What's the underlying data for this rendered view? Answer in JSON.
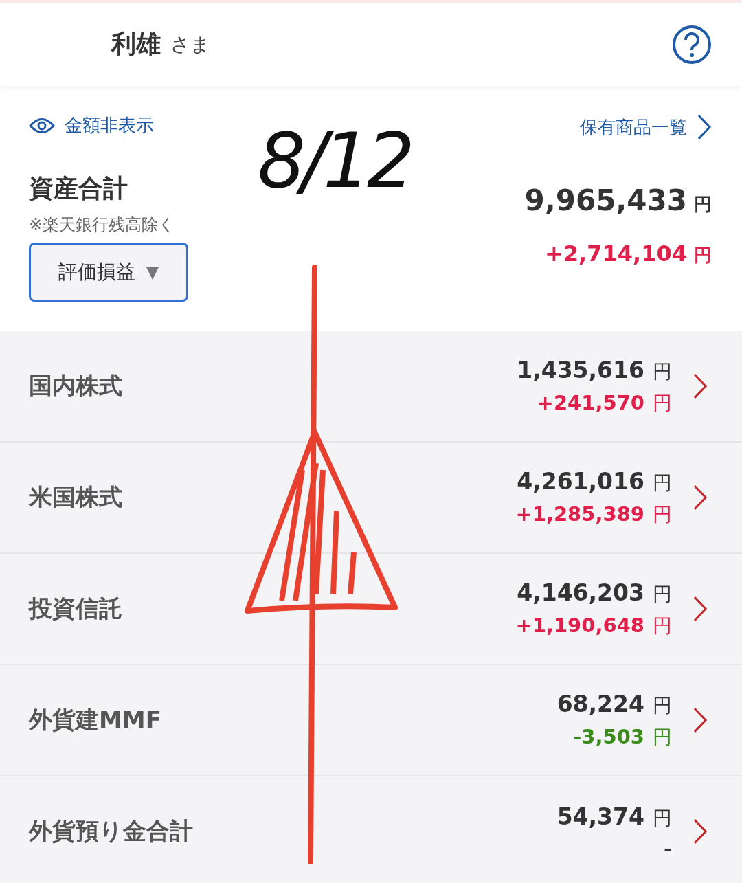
{
  "header": {
    "name": "利雄",
    "honorific": "さま"
  },
  "summary": {
    "hide_link": "金額非表示",
    "holdings_link": "保有商品一覧",
    "title": "資産合計",
    "note": "※楽天銀行残高除く",
    "total": "9,965,433",
    "total_unit": "円",
    "dropdown": "評価損益",
    "dropdown_caret": "▼",
    "gain": "+2,714,104",
    "gain_unit": "円",
    "kind": "gain"
  },
  "rows": [
    {
      "label": "国内株式",
      "amount": "1,435,616",
      "amount_unit": "円",
      "gain": "+241,570",
      "gain_unit": "円",
      "kind": "gain"
    },
    {
      "label": "米国株式",
      "amount": "4,261,016",
      "amount_unit": "円",
      "gain": "+1,285,389",
      "gain_unit": "円",
      "kind": "gain"
    },
    {
      "label": "投資信託",
      "amount": "4,146,203",
      "amount_unit": "円",
      "gain": "+1,190,648",
      "gain_unit": "円",
      "kind": "gain"
    },
    {
      "label": "外貨建MMF",
      "amount": "68,224",
      "amount_unit": "円",
      "gain": "-3,503",
      "gain_unit": "円",
      "kind": "loss"
    },
    {
      "label": "外貨預り金合計",
      "amount": "54,374",
      "amount_unit": "円",
      "gain": "-",
      "kind": "none"
    }
  ],
  "annotation": {
    "text": "8/12"
  }
}
